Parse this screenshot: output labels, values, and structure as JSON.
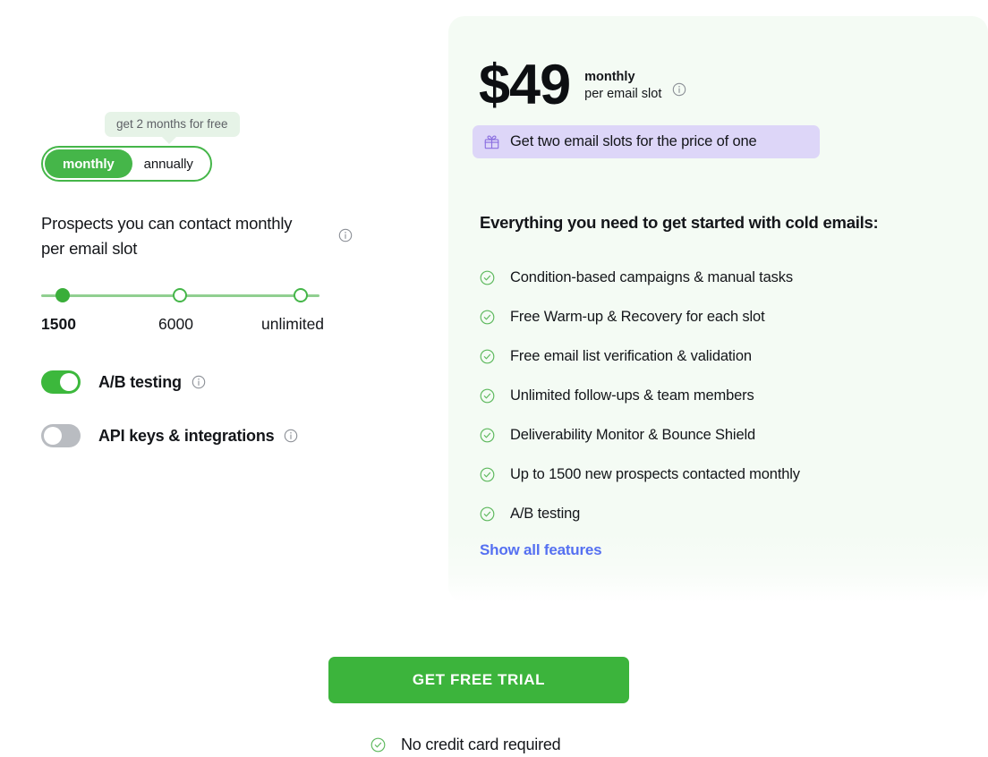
{
  "billing": {
    "tooltip": "get 2 months for free",
    "options": [
      {
        "label": "monthly",
        "state": "active"
      },
      {
        "label": "annually",
        "state": "inactive"
      }
    ]
  },
  "slider": {
    "label": "Prospects you can contact monthly per email slot",
    "info_icon": "info-icon",
    "stops": [
      {
        "label": "1500",
        "selected": true
      },
      {
        "label": "6000",
        "selected": false
      },
      {
        "label": "unlimited",
        "selected": false
      }
    ]
  },
  "options": [
    {
      "label": "A/B testing",
      "on": true,
      "info_icon": "info-icon"
    },
    {
      "label": "API keys & integrations",
      "on": false,
      "info_icon": "info-icon"
    }
  ],
  "plan": {
    "price": "$49",
    "period": "monthly",
    "unit": "per email slot",
    "price_info_icon": "info-icon",
    "promo": {
      "icon": "gift-icon",
      "text": "Get two email slots for the price of one",
      "background": "#ddd6f8",
      "icon_color": "#8b6fe0"
    },
    "features_title": "Everything you need to get started with cold emails:",
    "features": [
      "Condition-based campaigns & manual tasks",
      "Free Warm-up & Recovery for each slot",
      "Free email list verification & validation",
      "Unlimited follow-ups & team members",
      "Deliverability Monitor & Bounce Shield",
      "Up to 1500 new prospects contacted monthly",
      "A/B testing"
    ],
    "show_all_label": "Show all features",
    "show_all_color": "#5570f1",
    "check_icon": "check-circle-icon"
  },
  "cta": {
    "button_label": "GET FREE TRIAL",
    "button_color": "#3cb43c",
    "note": "No credit card required",
    "note_icon": "check-circle-icon"
  },
  "theme": {
    "green": "#45b649",
    "card_background": "#f4fbf4"
  }
}
